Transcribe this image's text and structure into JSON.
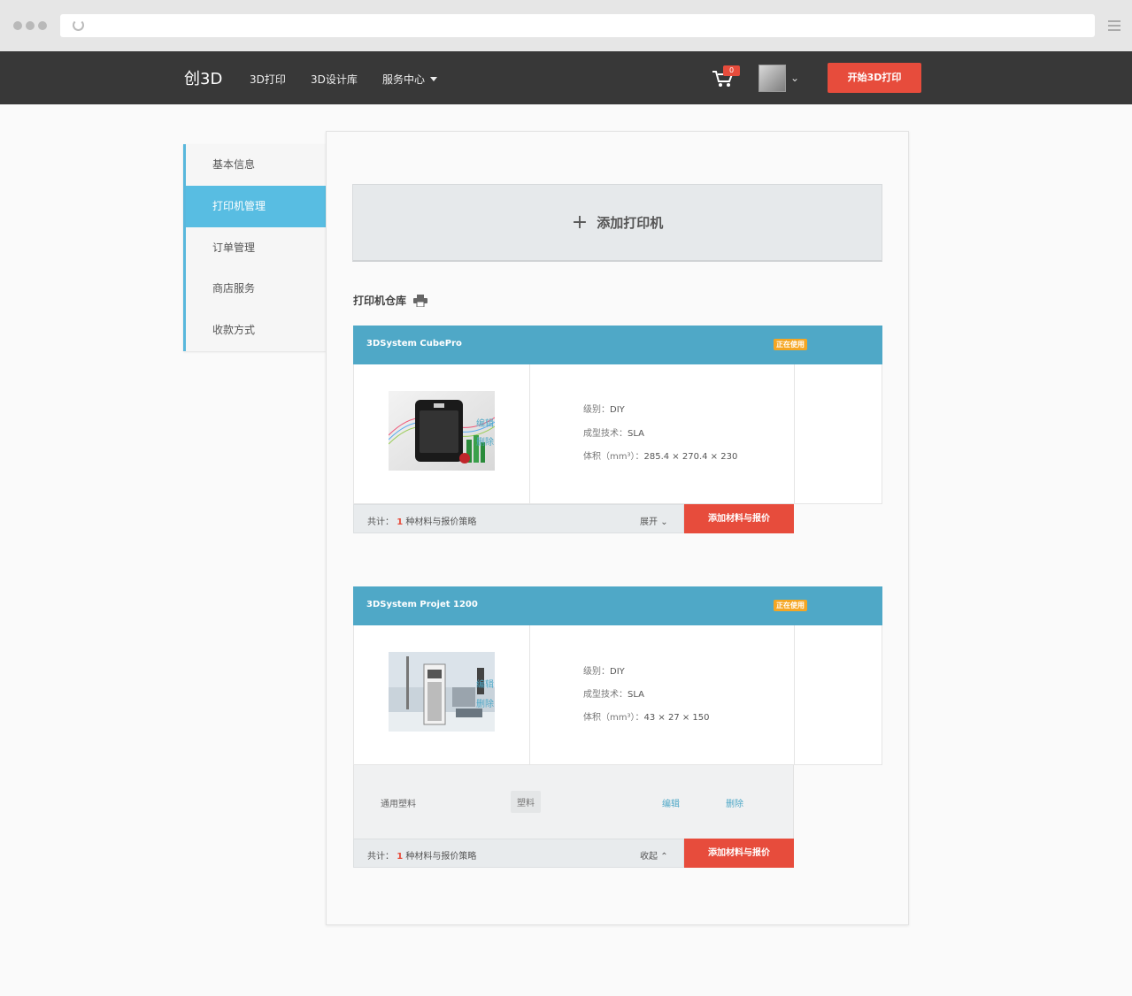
{
  "app": {
    "logo": "创3D",
    "nav": [
      "3D打印",
      "3D设计库",
      "服务中心"
    ],
    "cart_count": "0",
    "start_button": "开始3D打印"
  },
  "sidebar": {
    "items": [
      "基本信息",
      "打印机管理",
      "订单管理",
      "商店服务",
      "收款方式"
    ],
    "active": "打印机管理"
  },
  "main": {
    "add_printer": "添加打印机",
    "section_title": "打印机仓库",
    "printers": [
      {
        "name": "3DSystem  CubePro",
        "status": "正在使用",
        "specs": {
          "level_label": "级别：",
          "level": "DIY",
          "tech_label": "成型技术：",
          "tech": "SLA",
          "volume_label": "体积（mm³）：",
          "volume": "285.4 × 270.4 × 230"
        },
        "edit": "编辑",
        "delete": "删除",
        "summary_prefix": "共计：",
        "summary_count": "1",
        "summary_suffix": "种材料与报价策略",
        "toggle": "展开",
        "add_material": "添加材料与报价"
      },
      {
        "name": "3DSystem  Projet 1200",
        "status": "正在使用",
        "specs": {
          "level_label": "级别：",
          "level": "DIY",
          "tech_label": "成型技术：",
          "tech": "SLA",
          "volume_label": "体积（mm³）：",
          "volume": "43 × 27 × 150"
        },
        "edit": "编辑",
        "delete": "删除",
        "material": {
          "name": "通用塑料",
          "tag": "塑料",
          "edit": "编辑",
          "delete": "删除"
        },
        "summary_prefix": "共计：",
        "summary_count": "1",
        "summary_suffix": "种材料与报价策略",
        "toggle": "收起",
        "add_material": "添加材料与报价"
      }
    ]
  },
  "colors": {
    "accent": "#4fa8c7",
    "sidebar_active": "#58bde2",
    "primary": "#e74c3c",
    "badge": "#f5a623",
    "header": "#383838"
  }
}
